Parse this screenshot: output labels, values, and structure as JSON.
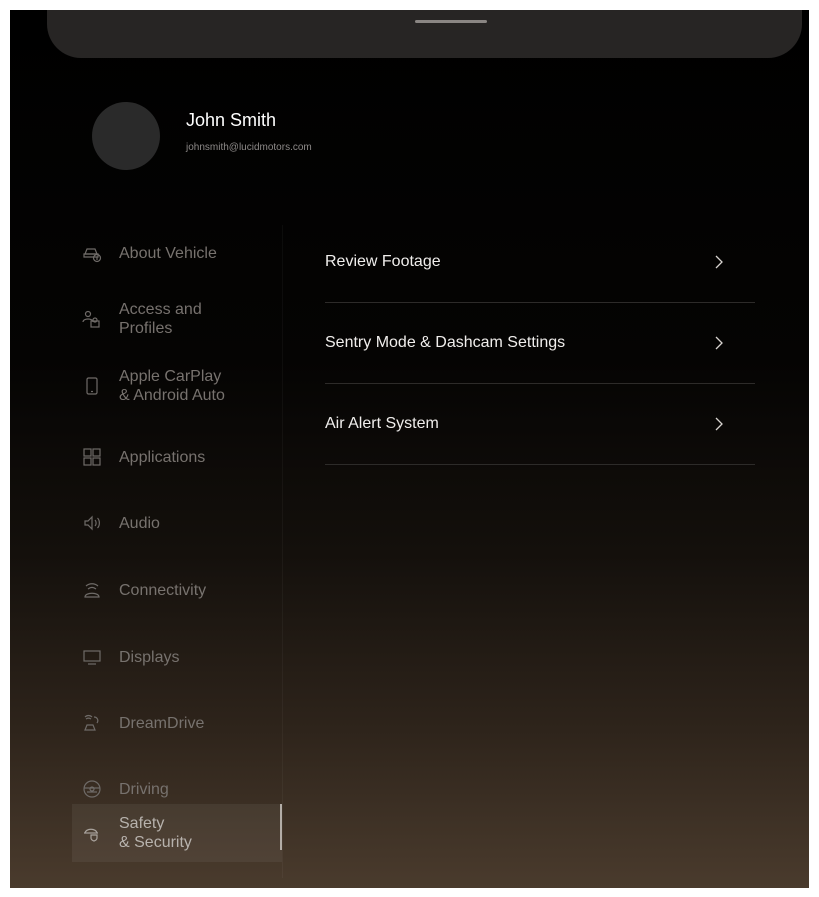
{
  "profile": {
    "name": "John Smith",
    "email": "johnsmith@lucidmotors.com"
  },
  "sidebar": {
    "items": [
      {
        "label": "About Vehicle",
        "icon": "car-info-icon"
      },
      {
        "label": "Access and\nProfiles",
        "icon": "profiles-icon"
      },
      {
        "label": "Apple CarPlay\n& Android Auto",
        "icon": "phone-icon"
      },
      {
        "label": "Applications",
        "icon": "grid-icon"
      },
      {
        "label": "Audio",
        "icon": "speaker-icon"
      },
      {
        "label": "Connectivity",
        "icon": "wifi-icon"
      },
      {
        "label": "Displays",
        "icon": "monitor-icon"
      },
      {
        "label": "DreamDrive",
        "icon": "dreamdrive-icon"
      },
      {
        "label": "Driving",
        "icon": "steering-wheel-icon"
      },
      {
        "label": "Safety\n& Security",
        "icon": "car-shield-icon",
        "active": true
      }
    ]
  },
  "content": {
    "rows": [
      {
        "label": "Review Footage"
      },
      {
        "label": "Sentry Mode & Dashcam Settings"
      },
      {
        "label": "Air Alert System"
      }
    ]
  },
  "colors": {
    "background_top": "#000000",
    "background_bottom": "#4a3b2d",
    "text_primary": "#f0eeec",
    "text_muted": "#77726e",
    "divider": "#2d2b29"
  }
}
